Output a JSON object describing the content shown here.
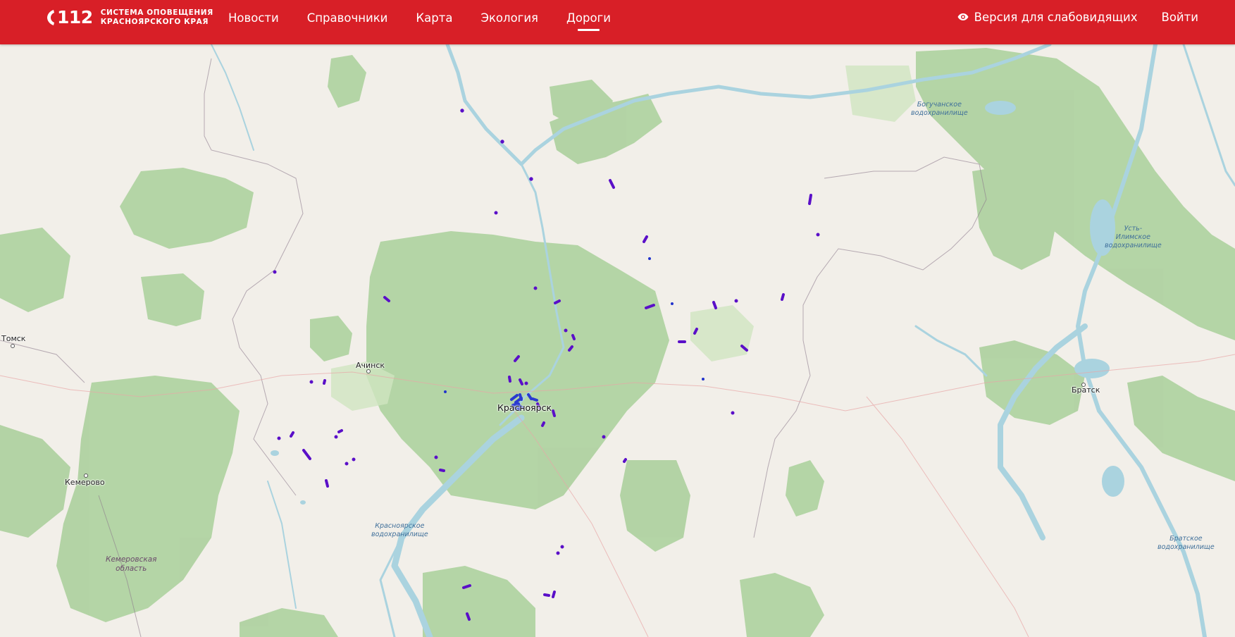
{
  "header": {
    "logo": {
      "number": "112",
      "line1": "СИСТЕМА ОПОВЕЩЕНИЯ",
      "line2": "КРАСНОЯРСКОГО КРАЯ"
    },
    "nav": [
      {
        "label": "Новости",
        "active": false
      },
      {
        "label": "Справочники",
        "active": false
      },
      {
        "label": "Карта",
        "active": false
      },
      {
        "label": "Экология",
        "active": false
      },
      {
        "label": "Дороги",
        "active": true
      }
    ],
    "accessibility_label": "Версия для слабовидящих",
    "login_label": "Войти",
    "accent_color": "#d81f27"
  },
  "map": {
    "cities": {
      "tomsk": "Томск",
      "achinsk": "Ачинск",
      "krasnoyarsk": "Красноярск",
      "kemerovo": "Кемерово",
      "bratsk": "Братск"
    },
    "water": {
      "boguchany": [
        "Богучанское",
        "водохранилище"
      ],
      "ust_ilimsk": [
        "Усть-",
        "Илимское",
        "водохранилище"
      ],
      "krasnoyarsk_res": [
        "Красноярское",
        "водохранилище"
      ],
      "bratsk_res": [
        "Братское",
        "водохранилище"
      ]
    },
    "regions": {
      "kemerovo_oblast": [
        "Кемеровская",
        "область"
      ]
    },
    "colors": {
      "background": "#f2efe9",
      "forest": "#add19e",
      "water": "#aad3df",
      "road_markers": "#5a0fc8"
    }
  }
}
